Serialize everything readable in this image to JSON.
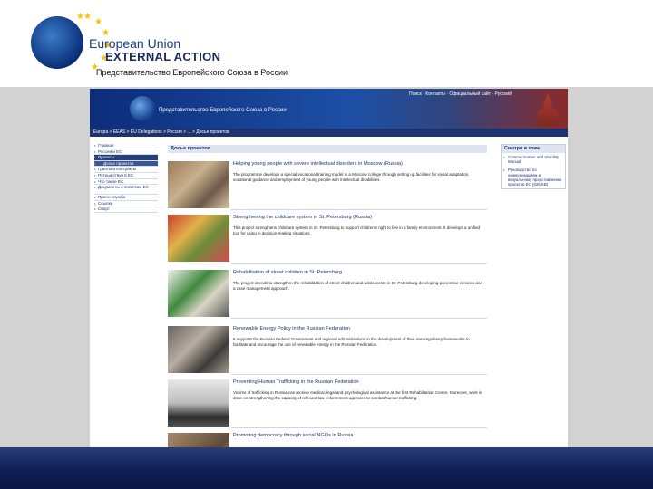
{
  "slide": {
    "logo_line1": "European Union",
    "logo_line2": "EXTERNAL ACTION",
    "caption": "Представительство Европейского Союза в России"
  },
  "site": {
    "header_title": "Представительство Европейского Союза в России",
    "top_links": "Поиск · Контакты · Официальный сайт · Русский",
    "breadcrumb": "Europa > EEAS > EU Delegations > Россия > ... > Досье проектов",
    "nav": [
      {
        "label": "Главная",
        "state": "normal"
      },
      {
        "label": "Россия и ЕС",
        "state": "normal"
      },
      {
        "label": "Проекты",
        "state": "active"
      },
      {
        "label": "Досье проектов",
        "state": "sub"
      },
      {
        "label": "Гранты и контракты",
        "state": "normal"
      },
      {
        "label": "Путешествуя в ЕС",
        "state": "normal"
      },
      {
        "label": "Что такое ЕС",
        "state": "normal"
      },
      {
        "label": "Документы и политика ЕС",
        "state": "tall"
      },
      {
        "label": "Пресс-служба",
        "state": "normal"
      },
      {
        "label": "Ссылки",
        "state": "normal"
      },
      {
        "label": "Спорт",
        "state": "normal"
      }
    ],
    "main_title": "Досье проектов",
    "projects": [
      {
        "title": "Helping young people with severe intellectual disorders in Moscow (Russia)",
        "desc": "The programme develops a special vocational training model in a Moscow college through setting up facilities for social adaptation, vocational guidance and employment of young people with intellectual disabilities."
      },
      {
        "title": "Strengthening the childcare system in St. Petersburg (Russia)",
        "desc": "This project strengthens childcare system in St. Petersburg to support children's right to live in a family environment. It develops a unified tool for using in decision-making situations."
      },
      {
        "title": "Rehabilitation of street children in St. Petersburg",
        "desc": "The project intends to strengthen the rehabilitation of street children and adolescents in St. Petersburg developing preventive services and a case management approach."
      },
      {
        "title": "Renewable Energy Policy in the Russian Federation",
        "desc": "It supports the Russian Federal Government and regional administrations in the development of their own regulatory frameworks to facilitate and encourage the use of renewable energy in the Russian Federation."
      },
      {
        "title": "Preventing Human Trafficking in the Russian Federation",
        "desc": "Victims of trafficking in Russia can receive medical, legal and psychological assistance at the first Rehabilitation Centre. Moreover, work is done on strengthening the capacity of relevant law enforcement agencies to combat human trafficking."
      },
      {
        "title": "Promoting democracy through social NGOs in Russia",
        "desc": ""
      }
    ],
    "right_title": "Смотри в тоже",
    "right_items": [
      "Communication and Visibility Manual",
      "Руководство по коммуникациям и визуальному представлению проектов ЕС (825 KB)"
    ]
  },
  "colors": {
    "site_header": "#0c2d7a",
    "breadcrumb": "#1b3470",
    "gray_band": "#d2d2d2",
    "bottom_band": "#0e1d52"
  }
}
